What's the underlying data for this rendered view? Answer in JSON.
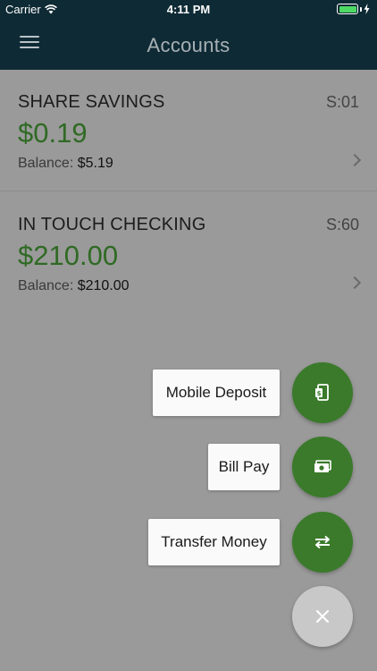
{
  "status_bar": {
    "carrier": "Carrier",
    "time": "4:11 PM"
  },
  "header": {
    "title": "Accounts"
  },
  "accounts": [
    {
      "name": "SHARE SAVINGS",
      "code": "S:01",
      "available": "$0.19",
      "balance_label": "Balance:",
      "balance": "$5.19"
    },
    {
      "name": "IN TOUCH CHECKING",
      "code": "S:60",
      "available": "$210.00",
      "balance_label": "Balance:",
      "balance": "$210.00"
    }
  ],
  "fab_menu": {
    "actions": [
      {
        "label": "Mobile Deposit",
        "icon": "mobile-deposit-icon"
      },
      {
        "label": "Bill Pay",
        "icon": "bill-pay-icon"
      },
      {
        "label": "Transfer Money",
        "icon": "transfer-icon"
      }
    ],
    "close_icon": "close-icon"
  },
  "colors": {
    "nav": "#0e2a35",
    "accent_green": "#3a7a2a",
    "amount_green": "#2f6a24",
    "overlay": "#9a9a9a"
  }
}
